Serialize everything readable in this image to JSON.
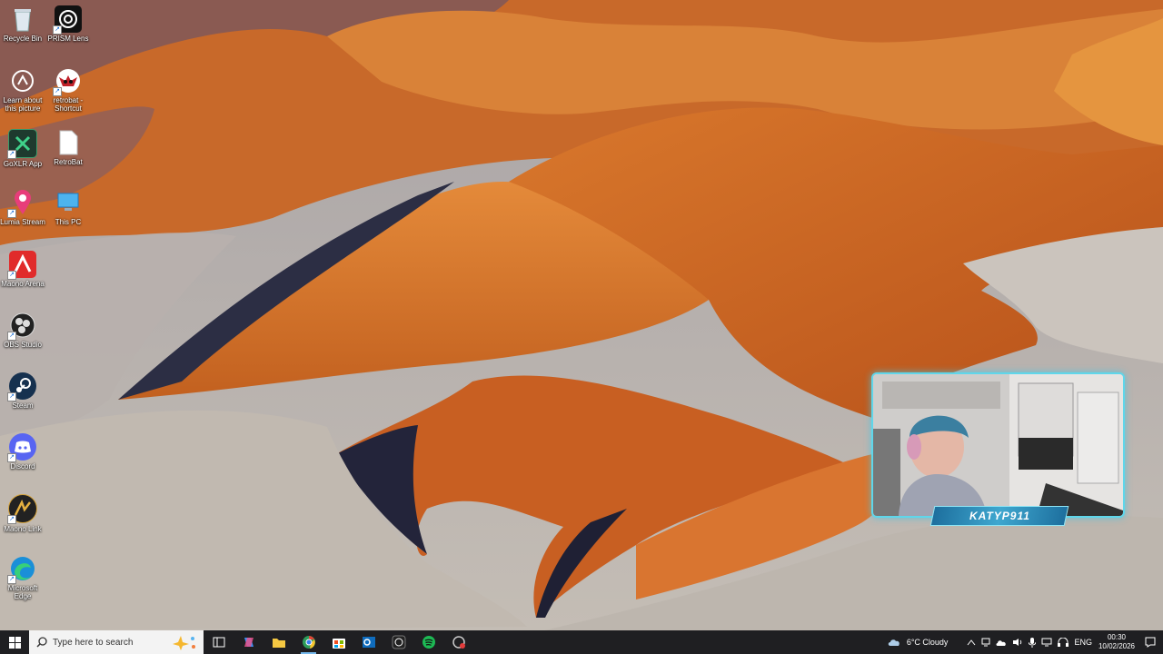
{
  "desktop": {
    "icons": [
      {
        "label": "Recycle Bin",
        "icon": "recycle-bin-icon"
      },
      {
        "label": "PRISM Lens",
        "icon": "prism-lens-icon"
      },
      {
        "label": "Learn about this picture",
        "icon": "learn-about-picture-icon"
      },
      {
        "label": "retrobat - Shortcut",
        "icon": "retrobat-icon"
      },
      {
        "label": "GoXLR App",
        "icon": "goxlr-icon"
      },
      {
        "label": "RetroBat",
        "icon": "file-icon"
      },
      {
        "label": "Lumia Stream",
        "icon": "lumia-stream-icon"
      },
      {
        "label": "This PC",
        "icon": "this-pc-icon"
      },
      {
        "label": "Maono Arena",
        "icon": "maono-arena-icon"
      },
      {
        "label": "OBS Studio",
        "icon": "obs-studio-icon"
      },
      {
        "label": "Steam",
        "icon": "steam-icon"
      },
      {
        "label": "Discord",
        "icon": "discord-icon"
      },
      {
        "label": "Maono Link",
        "icon": "maono-link-icon"
      },
      {
        "label": "Microsoft Edge",
        "icon": "edge-icon"
      }
    ]
  },
  "webcam": {
    "streamer_name": "KATYP911"
  },
  "taskbar": {
    "search_placeholder": "Type here to search",
    "pinned": [
      "task-view-icon",
      "copilot-icon",
      "file-explorer-icon",
      "chrome-icon",
      "store-icon",
      "outlook-icon",
      "obs-icon",
      "spotify-icon",
      "app-icon"
    ],
    "weather": "6°C Cloudy",
    "language": "ENG",
    "time": "00:30",
    "date": "10/02/2026"
  },
  "colors": {
    "taskbar_bg": "#1f1f22",
    "accent": "#76b9ed",
    "webcam_border": "#5fd6ea"
  }
}
